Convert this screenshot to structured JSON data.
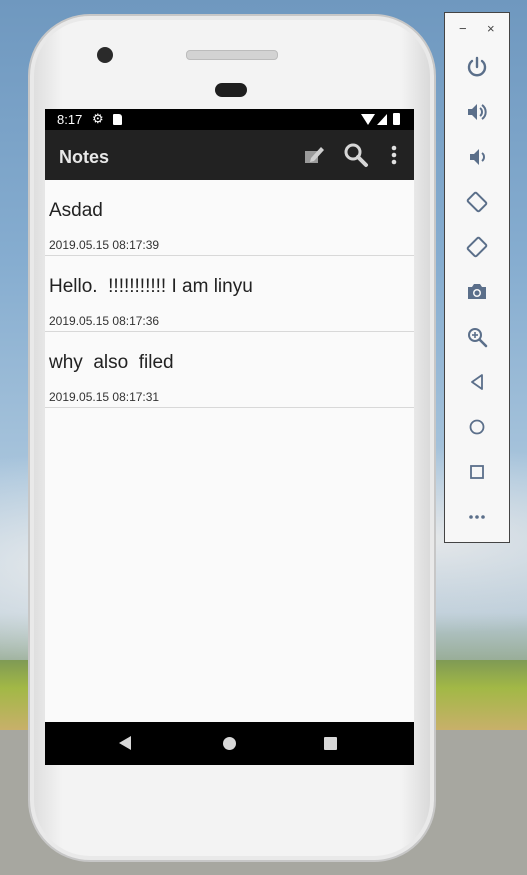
{
  "status_bar": {
    "time": "8:17"
  },
  "app_bar": {
    "title": "Notes"
  },
  "notes": [
    {
      "title": "Asdad",
      "date": "2019.05.15 08:17:39"
    },
    {
      "title": "Hello.  !!!!!!!!!!! I am linyu",
      "date": "2019.05.15 08:17:36"
    },
    {
      "title": "why  also  filed",
      "date": "2019.05.15 08:17:31"
    }
  ],
  "emulator_toolbar": {
    "minimize": "−",
    "close": "×",
    "buttons": [
      "power-icon",
      "volume-up-icon",
      "volume-down-icon",
      "rotate-left-icon",
      "rotate-right-icon",
      "camera-icon",
      "zoom-icon",
      "back-icon",
      "home-icon",
      "overview-icon",
      "more-icon"
    ]
  },
  "colors": {
    "app_bar": "#222222",
    "status_bar": "#000000",
    "screen_bg": "#fafafa",
    "toolbar_icon": "#5b6f8a"
  }
}
